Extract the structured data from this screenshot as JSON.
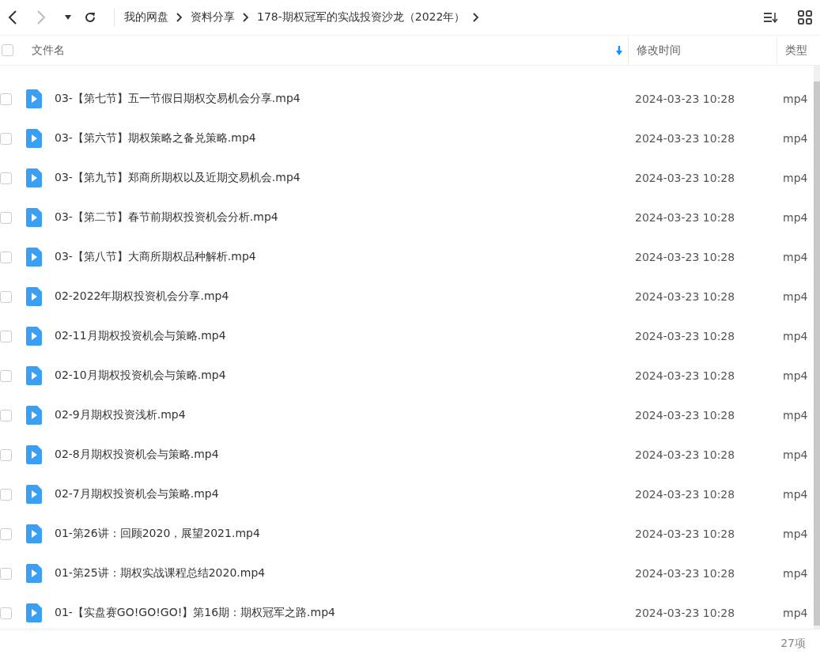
{
  "breadcrumb": [
    "我的网盘",
    "资料分享",
    "178-期权冠军的实战投资沙龙（2022年）"
  ],
  "table": {
    "all_checked": false,
    "columns": [
      {
        "label": "文件名",
        "sorted": true
      },
      {
        "label": "修改时间",
        "sorted": false
      },
      {
        "label": "类型",
        "sorted": false
      }
    ],
    "rows": [
      {
        "name": "03-【第七节】五一节假日期权交易机会分享.mp4",
        "modified": "2024-03-23 10:28",
        "type": "mp4",
        "checked": false
      },
      {
        "name": "03-【第六节】期权策略之备兑策略.mp4",
        "modified": "2024-03-23 10:28",
        "type": "mp4",
        "checked": false
      },
      {
        "name": "03-【第九节】郑商所期权以及近期交易机会.mp4",
        "modified": "2024-03-23 10:28",
        "type": "mp4",
        "checked": false
      },
      {
        "name": "03-【第二节】春节前期权投资机会分析.mp4",
        "modified": "2024-03-23 10:28",
        "type": "mp4",
        "checked": false
      },
      {
        "name": "03-【第八节】大商所期权品种解析.mp4",
        "modified": "2024-03-23 10:28",
        "type": "mp4",
        "checked": false
      },
      {
        "name": "02-2022年期权投资机会分享.mp4",
        "modified": "2024-03-23 10:28",
        "type": "mp4",
        "checked": false
      },
      {
        "name": "02-11月期权投资机会与策略.mp4",
        "modified": "2024-03-23 10:28",
        "type": "mp4",
        "checked": false
      },
      {
        "name": "02-10月期权投资机会与策略.mp4",
        "modified": "2024-03-23 10:28",
        "type": "mp4",
        "checked": false
      },
      {
        "name": "02-9月期权投资浅析.mp4",
        "modified": "2024-03-23 10:28",
        "type": "mp4",
        "checked": false
      },
      {
        "name": "02-8月期权投资机会与策略.mp4",
        "modified": "2024-03-23 10:28",
        "type": "mp4",
        "checked": false
      },
      {
        "name": "02-7月期权投资机会与策略.mp4",
        "modified": "2024-03-23 10:28",
        "type": "mp4",
        "checked": false
      },
      {
        "name": "01-第26讲：回顾2020，展望2021.mp4",
        "modified": "2024-03-23 10:28",
        "type": "mp4",
        "checked": false
      },
      {
        "name": "01-第25讲：期权实战课程总结2020.mp4",
        "modified": "2024-03-23 10:28",
        "type": "mp4",
        "checked": false
      },
      {
        "name": "01-【实盘赛GO!GO!GO!】第16期：期权冠军之路.mp4",
        "modified": "2024-03-23 10:28",
        "type": "mp4",
        "checked": false
      }
    ]
  },
  "status_bar": {
    "count": "27项"
  }
}
